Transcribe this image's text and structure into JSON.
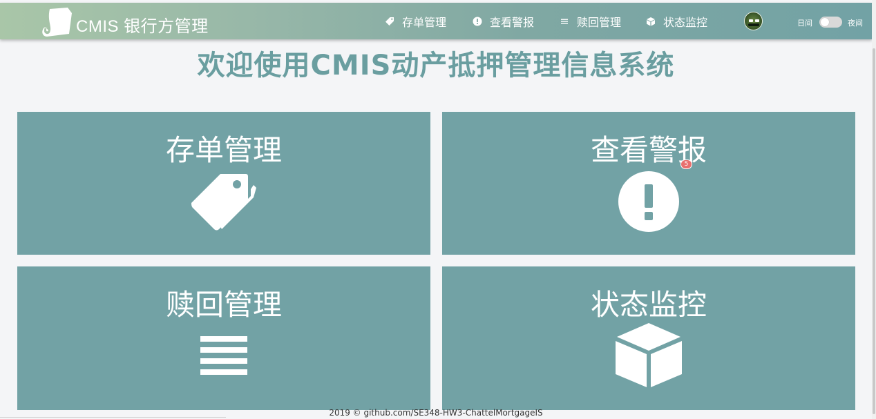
{
  "app": {
    "brand": "CMIS 银行方管理"
  },
  "nav": {
    "items": [
      {
        "label": "存单管理",
        "icon": "tag-icon"
      },
      {
        "label": "查看警报",
        "icon": "exclamation-circle-icon"
      },
      {
        "label": "赎回管理",
        "icon": "list-icon"
      },
      {
        "label": "状态监控",
        "icon": "cube-icon"
      }
    ]
  },
  "theme": {
    "day_label": "日间",
    "night_label": "夜间",
    "night_mode_on": false
  },
  "main": {
    "title": "欢迎使用CMIS动产抵押管理信息系统",
    "cards": [
      {
        "title": "存单管理",
        "icon": "tags-icon"
      },
      {
        "title": "查看警报",
        "icon": "exclamation-circle-icon",
        "badge": "5"
      },
      {
        "title": "赎回管理",
        "icon": "bars-icon"
      },
      {
        "title": "状态监控",
        "icon": "cube-icon"
      }
    ]
  },
  "footer": {
    "text": "2019 © github.com/SE348-HW3-ChattelMortgageIS"
  },
  "colors": {
    "card": "#72a2a5",
    "title": "#6a9ea0",
    "badge": "#e8706f",
    "background": "#f4f5f7"
  }
}
